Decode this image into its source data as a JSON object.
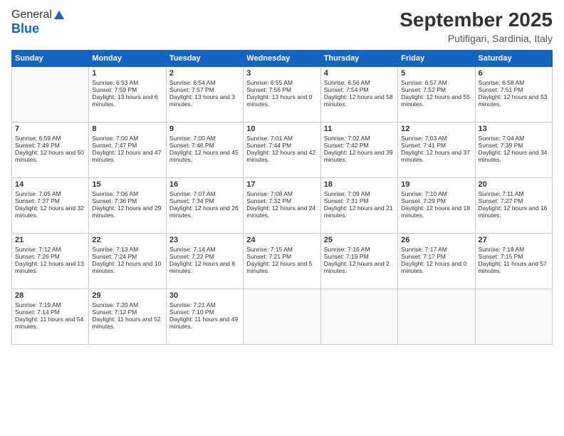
{
  "logo": {
    "line1": "General",
    "line2": "Blue"
  },
  "title": "September 2025",
  "location": "Putifigari, Sardinia, Italy",
  "weekdays": [
    "Sunday",
    "Monday",
    "Tuesday",
    "Wednesday",
    "Thursday",
    "Friday",
    "Saturday"
  ],
  "weeks": [
    [
      {
        "day": "",
        "sunrise": "",
        "sunset": "",
        "daylight": ""
      },
      {
        "day": "1",
        "sunrise": "Sunrise: 6:53 AM",
        "sunset": "Sunset: 7:59 PM",
        "daylight": "Daylight: 13 hours and 6 minutes."
      },
      {
        "day": "2",
        "sunrise": "Sunrise: 6:54 AM",
        "sunset": "Sunset: 7:57 PM",
        "daylight": "Daylight: 13 hours and 3 minutes."
      },
      {
        "day": "3",
        "sunrise": "Sunrise: 6:55 AM",
        "sunset": "Sunset: 7:56 PM",
        "daylight": "Daylight: 13 hours and 0 minutes."
      },
      {
        "day": "4",
        "sunrise": "Sunrise: 6:56 AM",
        "sunset": "Sunset: 7:54 PM",
        "daylight": "Daylight: 12 hours and 58 minutes."
      },
      {
        "day": "5",
        "sunrise": "Sunrise: 6:57 AM",
        "sunset": "Sunset: 7:52 PM",
        "daylight": "Daylight: 12 hours and 55 minutes."
      },
      {
        "day": "6",
        "sunrise": "Sunrise: 6:58 AM",
        "sunset": "Sunset: 7:51 PM",
        "daylight": "Daylight: 12 hours and 53 minutes."
      }
    ],
    [
      {
        "day": "7",
        "sunrise": "Sunrise: 6:59 AM",
        "sunset": "Sunset: 7:49 PM",
        "daylight": "Daylight: 12 hours and 50 minutes."
      },
      {
        "day": "8",
        "sunrise": "Sunrise: 7:00 AM",
        "sunset": "Sunset: 7:47 PM",
        "daylight": "Daylight: 12 hours and 47 minutes."
      },
      {
        "day": "9",
        "sunrise": "Sunrise: 7:00 AM",
        "sunset": "Sunset: 7:46 PM",
        "daylight": "Daylight: 12 hours and 45 minutes."
      },
      {
        "day": "10",
        "sunrise": "Sunrise: 7:01 AM",
        "sunset": "Sunset: 7:44 PM",
        "daylight": "Daylight: 12 hours and 42 minutes."
      },
      {
        "day": "11",
        "sunrise": "Sunrise: 7:02 AM",
        "sunset": "Sunset: 7:42 PM",
        "daylight": "Daylight: 12 hours and 39 minutes."
      },
      {
        "day": "12",
        "sunrise": "Sunrise: 7:03 AM",
        "sunset": "Sunset: 7:41 PM",
        "daylight": "Daylight: 12 hours and 37 minutes."
      },
      {
        "day": "13",
        "sunrise": "Sunrise: 7:04 AM",
        "sunset": "Sunset: 7:39 PM",
        "daylight": "Daylight: 12 hours and 34 minutes."
      }
    ],
    [
      {
        "day": "14",
        "sunrise": "Sunrise: 7:05 AM",
        "sunset": "Sunset: 7:37 PM",
        "daylight": "Daylight: 12 hours and 32 minutes."
      },
      {
        "day": "15",
        "sunrise": "Sunrise: 7:06 AM",
        "sunset": "Sunset: 7:36 PM",
        "daylight": "Daylight: 12 hours and 29 minutes."
      },
      {
        "day": "16",
        "sunrise": "Sunrise: 7:07 AM",
        "sunset": "Sunset: 7:34 PM",
        "daylight": "Daylight: 12 hours and 26 minutes."
      },
      {
        "day": "17",
        "sunrise": "Sunrise: 7:08 AM",
        "sunset": "Sunset: 7:32 PM",
        "daylight": "Daylight: 12 hours and 24 minutes."
      },
      {
        "day": "18",
        "sunrise": "Sunrise: 7:09 AM",
        "sunset": "Sunset: 7:31 PM",
        "daylight": "Daylight: 12 hours and 21 minutes."
      },
      {
        "day": "19",
        "sunrise": "Sunrise: 7:10 AM",
        "sunset": "Sunset: 7:29 PM",
        "daylight": "Daylight: 12 hours and 18 minutes."
      },
      {
        "day": "20",
        "sunrise": "Sunrise: 7:11 AM",
        "sunset": "Sunset: 7:27 PM",
        "daylight": "Daylight: 12 hours and 16 minutes."
      }
    ],
    [
      {
        "day": "21",
        "sunrise": "Sunrise: 7:12 AM",
        "sunset": "Sunset: 7:26 PM",
        "daylight": "Daylight: 12 hours and 13 minutes."
      },
      {
        "day": "22",
        "sunrise": "Sunrise: 7:13 AM",
        "sunset": "Sunset: 7:24 PM",
        "daylight": "Daylight: 12 hours and 10 minutes."
      },
      {
        "day": "23",
        "sunrise": "Sunrise: 7:14 AM",
        "sunset": "Sunset: 7:22 PM",
        "daylight": "Daylight: 12 hours and 8 minutes."
      },
      {
        "day": "24",
        "sunrise": "Sunrise: 7:15 AM",
        "sunset": "Sunset: 7:21 PM",
        "daylight": "Daylight: 12 hours and 5 minutes."
      },
      {
        "day": "25",
        "sunrise": "Sunrise: 7:16 AM",
        "sunset": "Sunset: 7:19 PM",
        "daylight": "Daylight: 12 hours and 2 minutes."
      },
      {
        "day": "26",
        "sunrise": "Sunrise: 7:17 AM",
        "sunset": "Sunset: 7:17 PM",
        "daylight": "Daylight: 12 hours and 0 minutes."
      },
      {
        "day": "27",
        "sunrise": "Sunrise: 7:18 AM",
        "sunset": "Sunset: 7:15 PM",
        "daylight": "Daylight: 11 hours and 57 minutes."
      }
    ],
    [
      {
        "day": "28",
        "sunrise": "Sunrise: 7:19 AM",
        "sunset": "Sunset: 7:14 PM",
        "daylight": "Daylight: 11 hours and 54 minutes."
      },
      {
        "day": "29",
        "sunrise": "Sunrise: 7:20 AM",
        "sunset": "Sunset: 7:12 PM",
        "daylight": "Daylight: 11 hours and 52 minutes."
      },
      {
        "day": "30",
        "sunrise": "Sunrise: 7:21 AM",
        "sunset": "Sunset: 7:10 PM",
        "daylight": "Daylight: 11 hours and 49 minutes."
      },
      {
        "day": "",
        "sunrise": "",
        "sunset": "",
        "daylight": ""
      },
      {
        "day": "",
        "sunrise": "",
        "sunset": "",
        "daylight": ""
      },
      {
        "day": "",
        "sunrise": "",
        "sunset": "",
        "daylight": ""
      },
      {
        "day": "",
        "sunrise": "",
        "sunset": "",
        "daylight": ""
      }
    ]
  ]
}
